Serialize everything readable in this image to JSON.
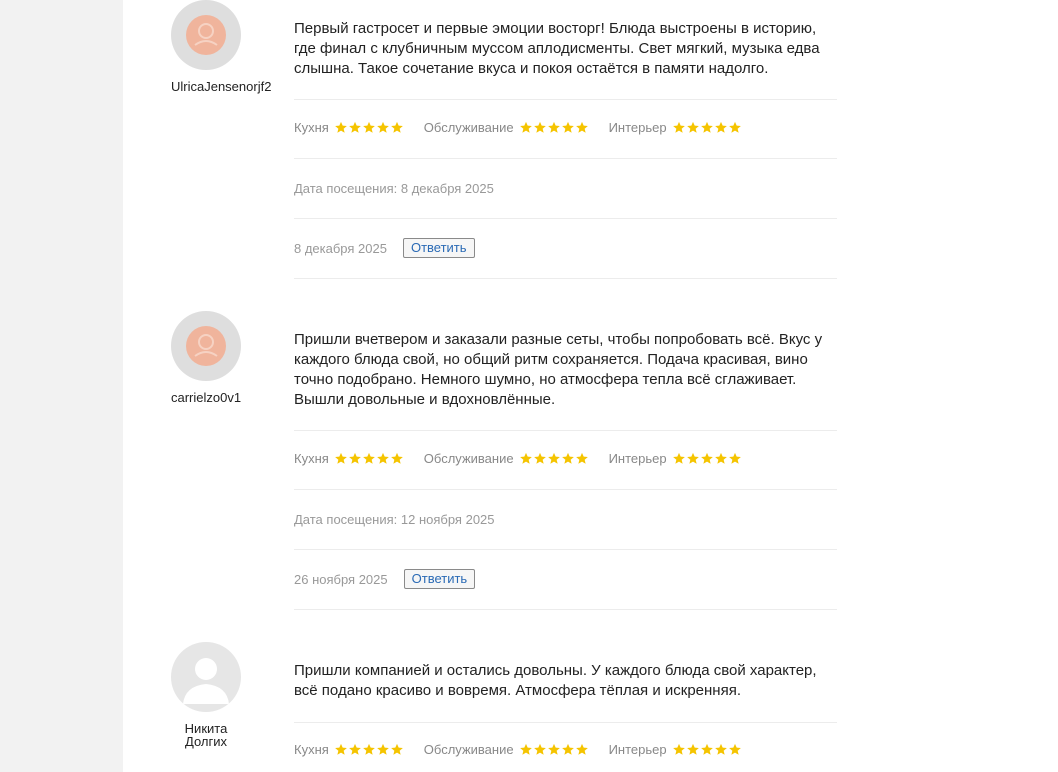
{
  "reviews": [
    {
      "username": "UlricaJensenorjf2",
      "avatar_icon": "user-avatar-placeholder-icon",
      "text": "Первый гастросет и первые эмоции восторг! Блюда выстроены в историю, где финал с клубничным муссом аплодисменты. Свет мягкий, музыка едва слышна. Такое сочетание вкуса и покоя остаётся в памяти надолго.",
      "ratings": [
        {
          "label": "Кухня",
          "stars": 5
        },
        {
          "label": "Обслуживание",
          "stars": 5
        },
        {
          "label": "Интерьер",
          "stars": 5
        }
      ],
      "visit_date": "Дата посещения: 8 декабря 2025",
      "date": "8 декабря 2025",
      "reply_label": "Ответить"
    },
    {
      "username": "carrielzo0v1",
      "avatar_icon": "user-avatar-placeholder-icon",
      "text": "Пришли вчетвером и заказали разные сеты, чтобы попробовать всё. Вкус у каждого блюда свой, но общий ритм сохраняется. Подача красивая, вино точно подобрано. Немного шумно, но атмосфера тепла всё сглаживает. Вышли довольные и вдохновлённые.",
      "ratings": [
        {
          "label": "Кухня",
          "stars": 5
        },
        {
          "label": "Обслуживание",
          "stars": 5
        },
        {
          "label": "Интерьер",
          "stars": 5
        }
      ],
      "visit_date": "Дата посещения: 12 ноября 2025",
      "date": "26 ноября 2025",
      "reply_label": "Ответить"
    },
    {
      "username": "Никита Долгих",
      "avatar_icon": "user-silhouette-icon",
      "text": "Пришли компанией и остались довольны. У каждого блюда свой характер, всё подано красиво и вовремя. Атмосфера тёплая и искренняя.",
      "ratings": [
        {
          "label": "Кухня",
          "stars": 5
        },
        {
          "label": "Обслуживание",
          "stars": 5
        },
        {
          "label": "Интерьер",
          "stars": 5
        }
      ],
      "visit_date": "",
      "date": "",
      "reply_label": ""
    }
  ],
  "colors": {
    "star": "#f5c400",
    "avatar_placeholder": "#f0b49c",
    "avatar_bg": "#dedede",
    "reply_text": "#2a6ab5"
  }
}
